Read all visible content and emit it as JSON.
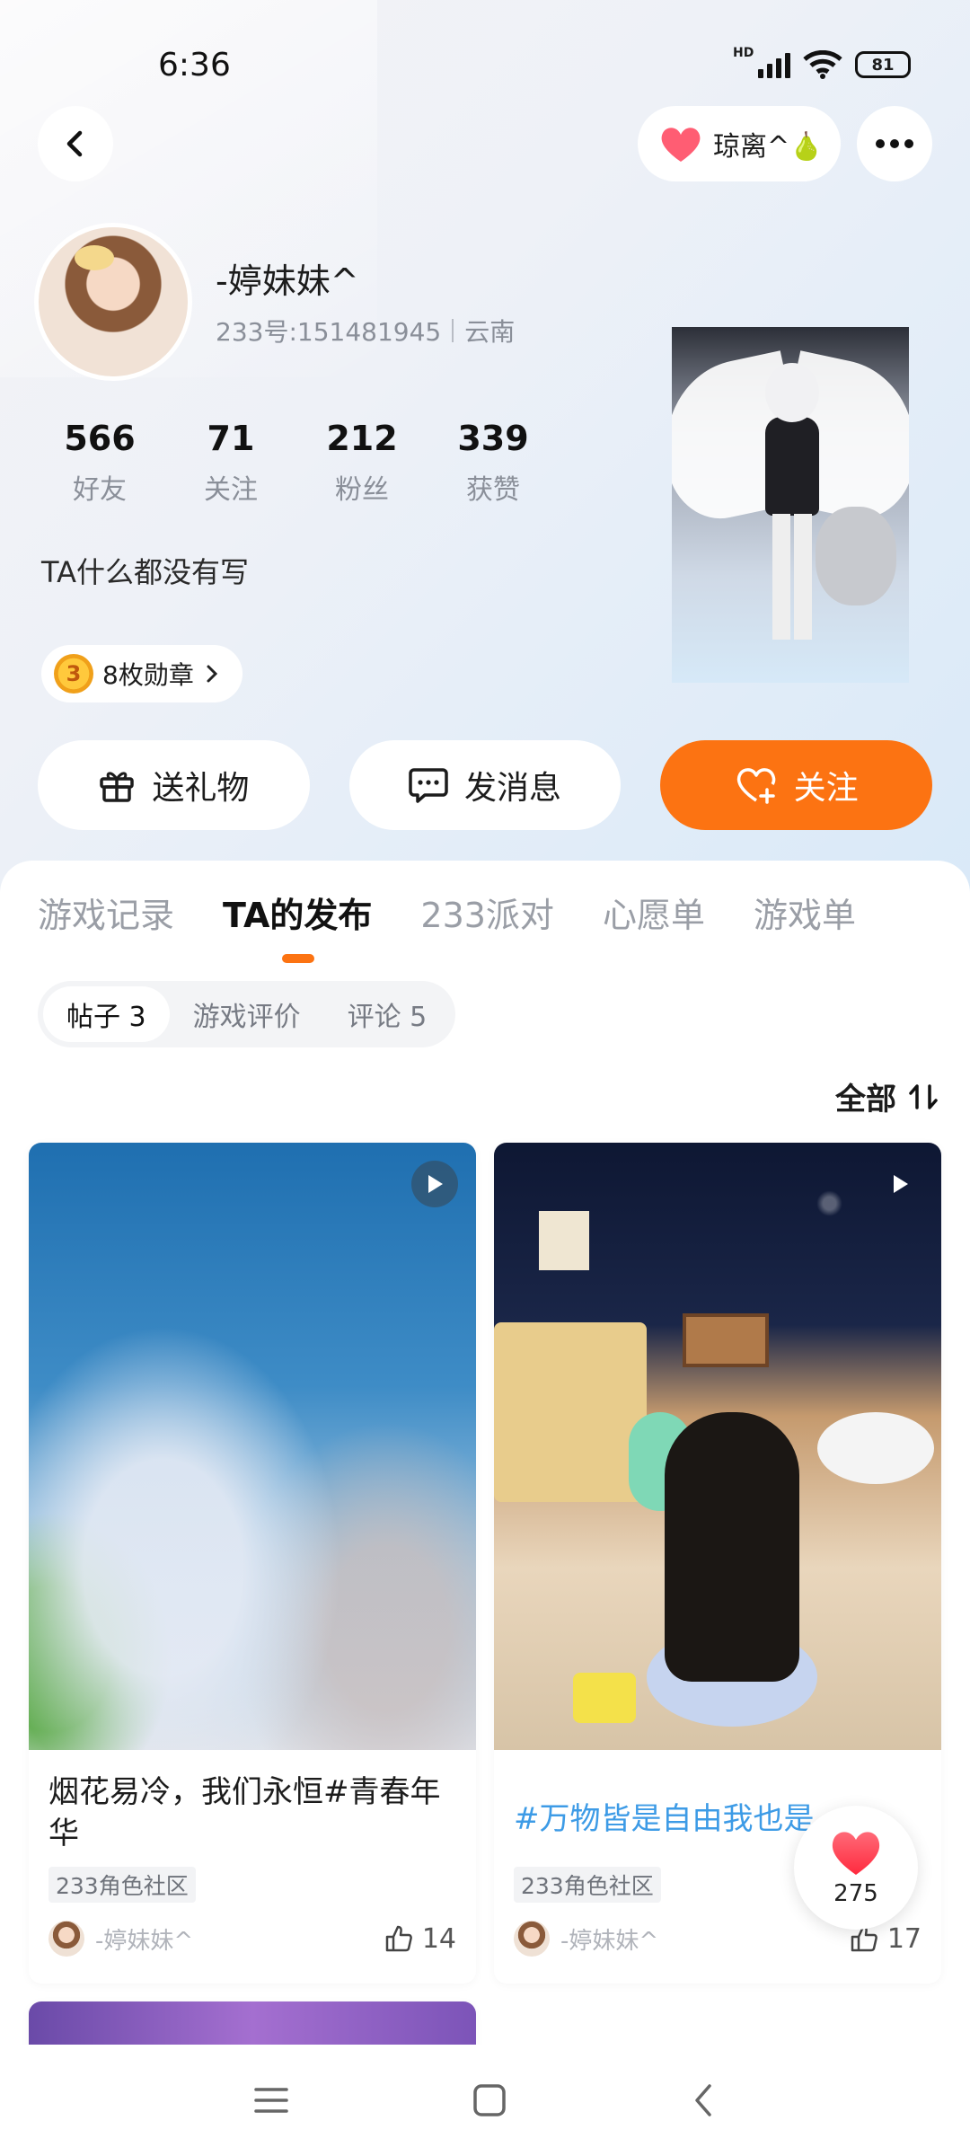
{
  "status_bar": {
    "time": "6:36",
    "network": "HD",
    "battery": "81"
  },
  "top_nav": {
    "companion_name": "琼离^🍐"
  },
  "profile": {
    "nickname": "-婷妹妹^",
    "id_label": "233号:151481945",
    "location": "云南",
    "stats": [
      {
        "value": "566",
        "label": "好友"
      },
      {
        "value": "71",
        "label": "关注"
      },
      {
        "value": "212",
        "label": "粉丝"
      },
      {
        "value": "339",
        "label": "获赞"
      }
    ],
    "bio": "TA什么都没有写",
    "medal_level": "3",
    "medals_label": "8枚勋章"
  },
  "actions": {
    "gift": "送礼物",
    "message": "发消息",
    "follow": "关注"
  },
  "tabs": [
    "游戏记录",
    "TA的发布",
    "233派对",
    "心愿单",
    "游戏单"
  ],
  "active_tab": "TA的发布",
  "subtabs": [
    "帖子 3",
    "游戏评价",
    "评论 5"
  ],
  "sort": {
    "label": "全部"
  },
  "posts": [
    {
      "title": "烟花易冷，我们永恒#青春年华",
      "community": "233角色社区",
      "author": "-婷妹妹^",
      "likes": "14"
    },
    {
      "title": "#万物皆是自由我也是",
      "community": "233角色社区",
      "author": "-婷妹妹^",
      "likes": "17"
    }
  ],
  "floating_like": {
    "count": "275"
  },
  "colors": {
    "accent": "#fc7312",
    "hashtag": "#3d9be6",
    "heart": "#ff3c4e"
  }
}
